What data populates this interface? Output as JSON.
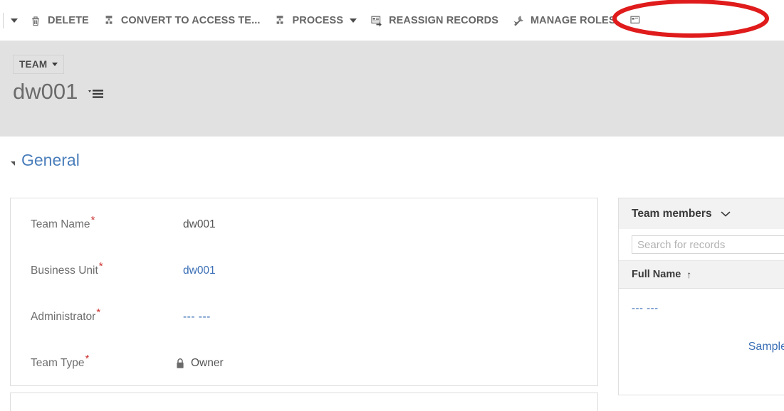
{
  "commandbar": {
    "overflow_caret_icon": "chevron-down-icon",
    "buttons": [
      {
        "label": "DELETE",
        "icon": "trash-icon",
        "has_caret": false
      },
      {
        "label": "CONVERT TO ACCESS TE...",
        "icon": "team-icon",
        "has_caret": false
      },
      {
        "label": "PROCESS",
        "icon": "team-icon",
        "has_caret": true
      },
      {
        "label": "REASSIGN RECORDS",
        "icon": "reassign-records-icon",
        "has_caret": false
      },
      {
        "label": "MANAGE ROLES",
        "icon": "wrench-icon",
        "has_caret": false
      }
    ]
  },
  "record_header": {
    "entity_chip_label": "TEAM",
    "entity_chip_caret_icon": "caret-down-icon",
    "record_title": "dw001",
    "form_selector_icon": "form-selector-icon"
  },
  "section": {
    "collapse_icon": "triangle-collapse-icon",
    "title": "General"
  },
  "form": {
    "required_marker": "*",
    "fields": [
      {
        "label": "Team Name",
        "required": true,
        "value": "dw001",
        "style": "text"
      },
      {
        "label": "Business Unit",
        "required": true,
        "value": "dw001",
        "style": "link"
      },
      {
        "label": "Administrator",
        "required": true,
        "value": "--- ---",
        "style": "link"
      },
      {
        "label": "Team Type",
        "required": true,
        "value": "Owner",
        "style": "locked",
        "icon": "lock-icon"
      }
    ]
  },
  "subgrid": {
    "title": "Team members",
    "expand_icon": "chevron-down-icon",
    "search_placeholder": "Search for records",
    "search_value": "",
    "column_header": "Full Name",
    "sort_indicator": "↑",
    "rows": [
      {
        "full_name": "--- ---"
      },
      {
        "full_name": "Sample"
      }
    ]
  },
  "annotation": {
    "shape": "ellipse",
    "color": "#e01b1b",
    "target": "MANAGE ROLES"
  },
  "colors": {
    "command_label": "#666666",
    "link": "#3b6fb6",
    "section_title": "#4a7ebb",
    "required_star": "#cc3333",
    "header_band": "#e1e1e1",
    "annotation_red": "#e01b1b"
  }
}
